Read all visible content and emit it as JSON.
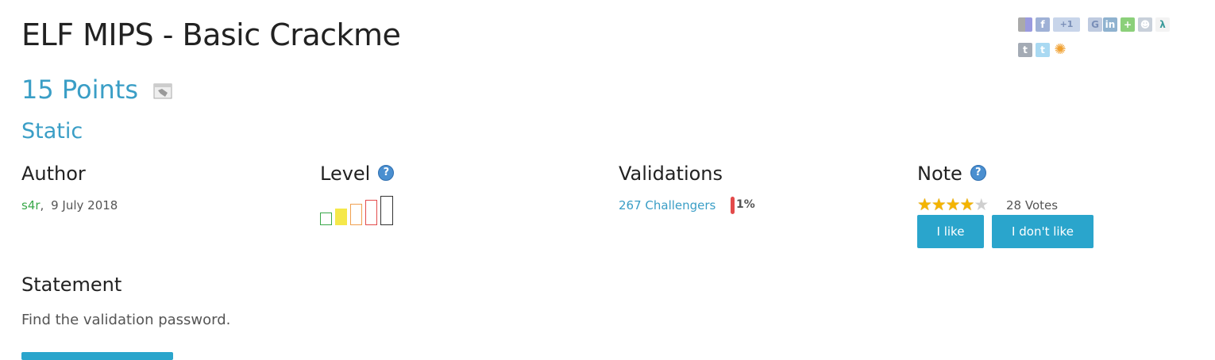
{
  "challenge": {
    "title": "ELF MIPS - Basic Crackme",
    "points": "15 Points",
    "type": "Static"
  },
  "author": {
    "heading": "Author",
    "name": "s4r",
    "sep": ",",
    "date": "9 July 2018"
  },
  "level": {
    "heading": "Level",
    "help": "?",
    "value": 2,
    "max": 5,
    "colors": [
      "#3aa84a",
      "#f5e84a",
      "#f0a050",
      "#e34b4b",
      "#333333"
    ]
  },
  "validations": {
    "heading": "Validations",
    "challengers": "267 Challengers",
    "percent_label": "1%",
    "bar_color": "#e34b4b"
  },
  "note": {
    "heading": "Note",
    "help": "?",
    "rating": 4,
    "max": 5,
    "votes": "28 Votes",
    "like_label": "I like",
    "dislike_label": "I don't like"
  },
  "statement": {
    "heading": "Statement",
    "text": "Find the validation password."
  },
  "share_icons": [
    {
      "name": "delicious-icon",
      "glyph": "",
      "color": "#9a9adf"
    },
    {
      "name": "facebook-icon",
      "glyph": "f",
      "color": "#9fb1d6"
    },
    {
      "name": "google-plus-one-icon",
      "glyph": "+1",
      "color": "#c8d5ea"
    },
    {
      "name": "google-icon",
      "glyph": "G",
      "color": "#bfcbe0"
    },
    {
      "name": "linkedin-icon",
      "glyph": "in",
      "color": "#8fb2cf"
    },
    {
      "name": "add-icon",
      "glyph": "+",
      "color": "#8bd07a"
    },
    {
      "name": "reddit-icon",
      "glyph": "☻",
      "color": "#c8d0da"
    },
    {
      "name": "viadeo-icon",
      "glyph": "λ",
      "color": "#f3f3f3"
    },
    {
      "name": "tumblr-icon",
      "glyph": "t",
      "color": "#a4abb5"
    },
    {
      "name": "twitter-icon",
      "glyph": "t",
      "color": "#a9d9f2"
    },
    {
      "name": "sunflower-icon",
      "glyph": "✺",
      "color": "#fde7b0"
    }
  ]
}
